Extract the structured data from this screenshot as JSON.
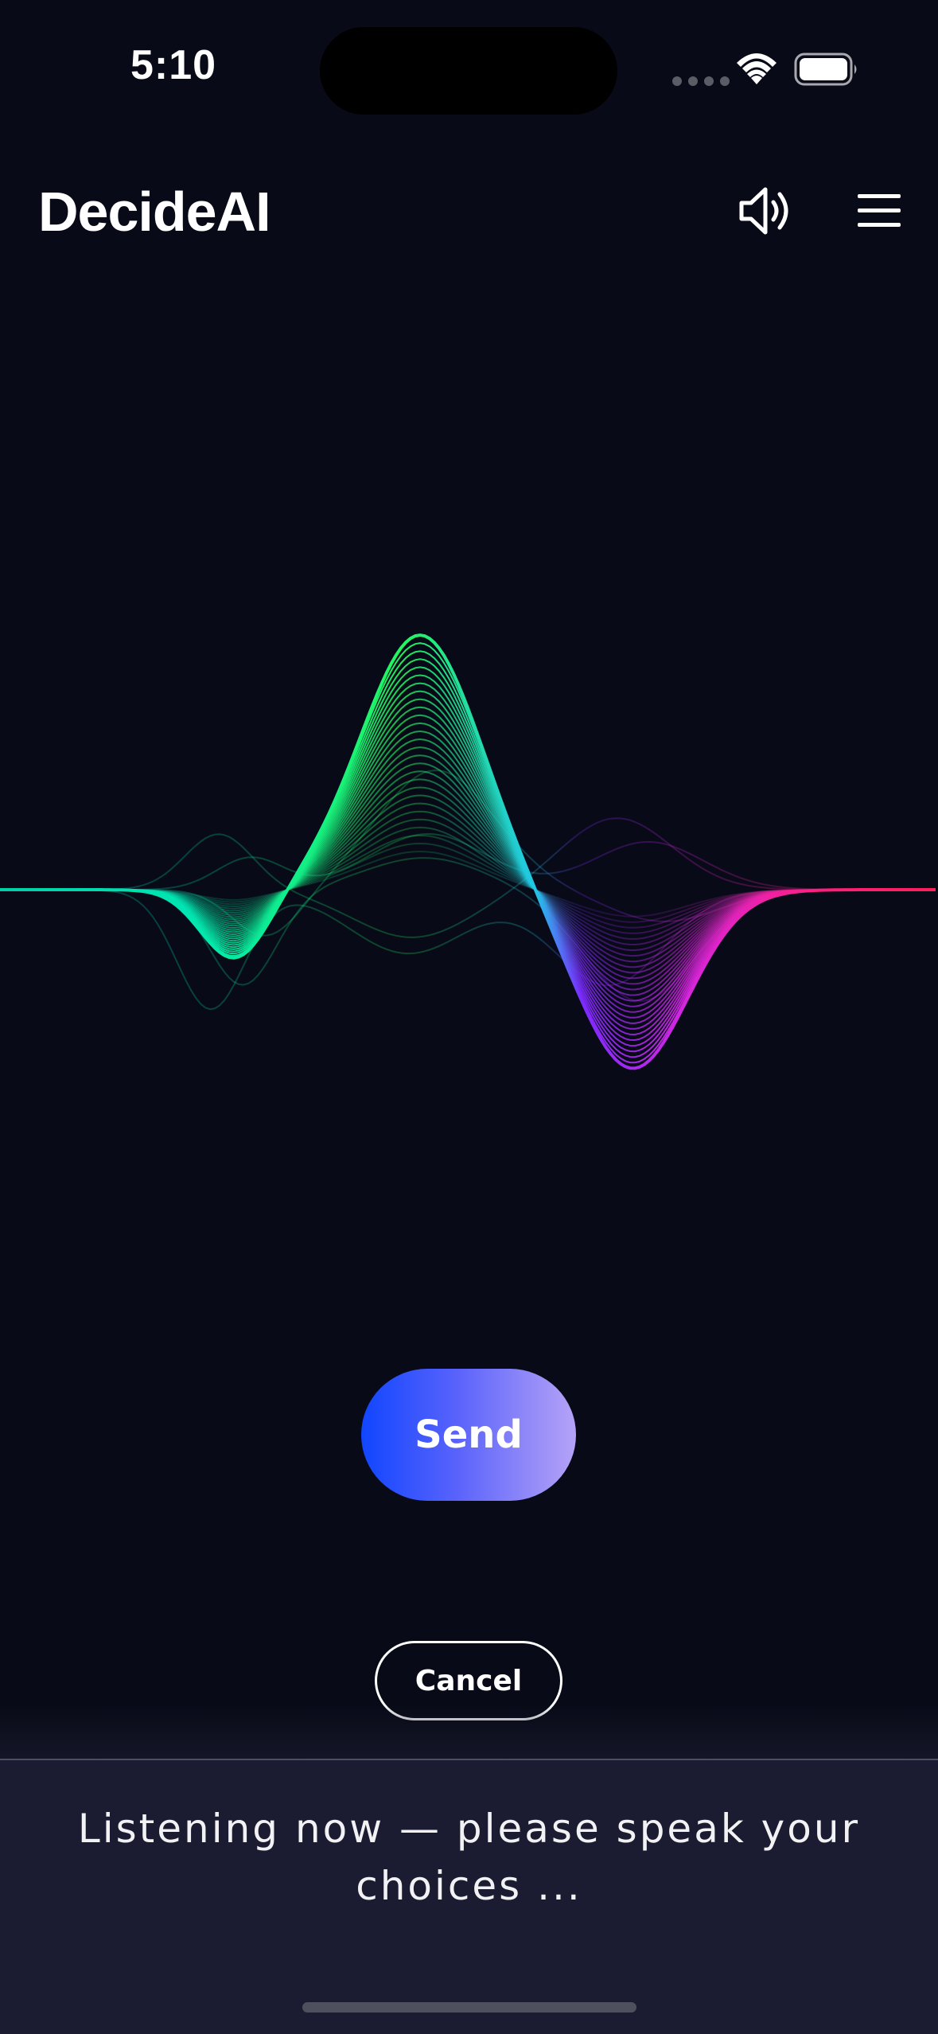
{
  "status_bar": {
    "time": "5:10"
  },
  "header": {
    "title": "DecideAI",
    "speaker_icon": "speaker-volume-icon",
    "menu_icon": "hamburger-menu-icon"
  },
  "waveform": {
    "colors": [
      "#00e7b3",
      "#23f65f",
      "#21c7e6",
      "#7b2bff",
      "#d626e0",
      "#ff1f5a"
    ]
  },
  "actions": {
    "send_label": "Send",
    "cancel_label": "Cancel"
  },
  "footer": {
    "listening_text": "Listening now — please speak your choices ..."
  },
  "colors": {
    "background": "#080a17",
    "panel": "#1b1c31",
    "send_gradient_start": "#1146ff",
    "send_gradient_end": "#b6a3f7"
  }
}
